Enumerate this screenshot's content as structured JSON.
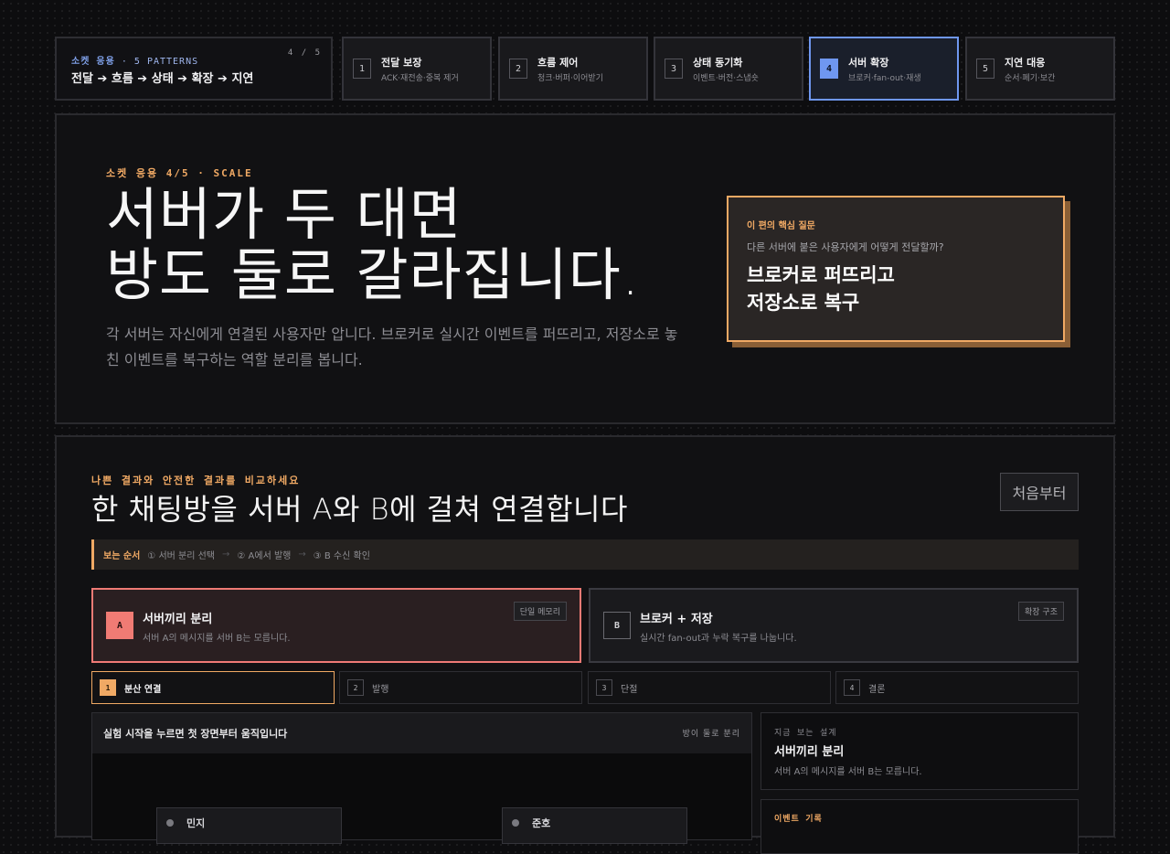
{
  "overview": {
    "kicker": "소켓 응용",
    "kicker_extra": "· 5 PATTERNS",
    "count": "4 / 5",
    "flow": "전달 ➔ 흐름 ➔ 상태 ➔ 확장 ➔ 지연"
  },
  "steps": [
    {
      "num": "1",
      "title": "전달 보장",
      "sub": "ACK·재전송·중복 제거"
    },
    {
      "num": "2",
      "title": "흐름 제어",
      "sub": "청크·버퍼·이어받기"
    },
    {
      "num": "3",
      "title": "상태 동기화",
      "sub": "이벤트·버전·스냅숏"
    },
    {
      "num": "4",
      "title": "서버 확장",
      "sub": "브로커·fan-out·재생"
    },
    {
      "num": "5",
      "title": "지연 대응",
      "sub": "순서·폐기·보간"
    }
  ],
  "hero": {
    "kicker": "소켓 응용 4/5 · SCALE",
    "title_line1": "서버가 두 대면",
    "title_line2": "방도 둘로 갈라집니다.",
    "desc": "각 서버는 자신에게 연결된 사용자만 압니다. 브로커로 실시간 이벤트를 퍼뜨리고, 저장소로 놓친 이벤트를 복구하는 역할 분리를 봅니다."
  },
  "question": {
    "label": "이 편의 핵심 질문",
    "question": "다른 서버에 붙은 사용자에게 어떻게 전달할까?",
    "answer_line1": "브로커로 퍼뜨리고",
    "answer_line2": "저장소로 복구"
  },
  "section": {
    "kicker": "나쁜 결과와 안전한 결과를 비교하세요",
    "title": "한 채팅방을 서버 A와 B에 걸쳐 연결합니다",
    "restart": "처음부터"
  },
  "order": {
    "heading": "보는 순서",
    "steps": [
      "① 서버 분리 선택",
      "② A에서 발행",
      "③ B 수신 확인"
    ],
    "sep": "→"
  },
  "options": [
    {
      "badge": "A",
      "title": "서버끼리 분리",
      "sub": "서버 A의 메시지를 서버 B는 모릅니다.",
      "tag": "단일 메모리"
    },
    {
      "badge": "B",
      "title": "브로커 + 저장",
      "sub": "실시간 fan-out과 누락 복구를 나눕니다.",
      "tag": "확장 구조"
    }
  ],
  "tabs": [
    {
      "num": "1",
      "label": "분산 연결"
    },
    {
      "num": "2",
      "label": "발행"
    },
    {
      "num": "3",
      "label": "단절"
    },
    {
      "num": "4",
      "label": "결론"
    }
  ],
  "stage": {
    "title": "실험 시작을 누르면 첫 장면부터 움직입니다",
    "right": "방이 둘로 분리",
    "node_left": "민지",
    "node_right": "준호"
  },
  "design": {
    "kicker": "지금 보는 설계",
    "title": "서버끼리 분리",
    "sub": "서버 A의 메시지를 서버 B는 모릅니다."
  },
  "events": {
    "kicker": "이벤트 기록"
  },
  "colors": {
    "accent_orange": "#f0a964",
    "accent_blue": "#6f97f0",
    "accent_red": "#ee7a75",
    "background": "#0d0d0f"
  }
}
